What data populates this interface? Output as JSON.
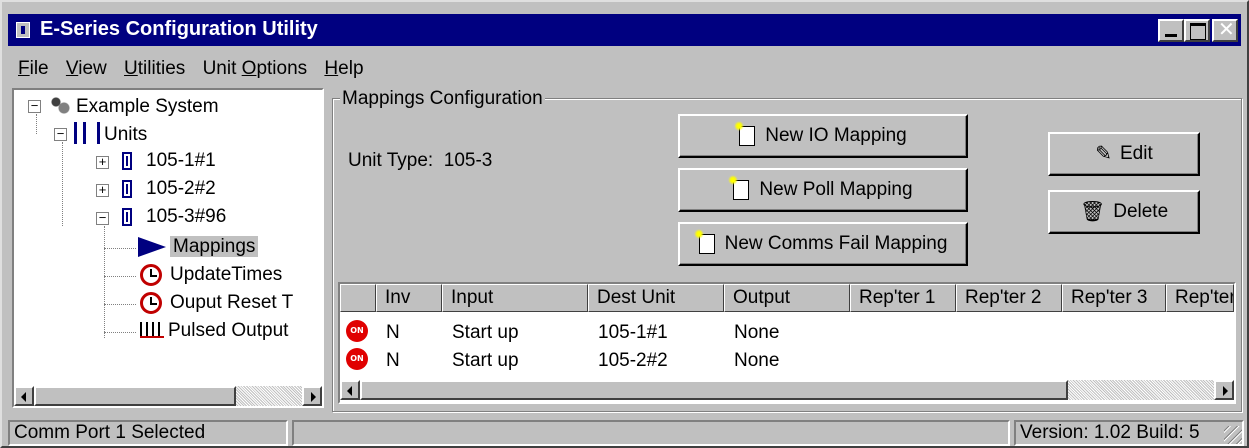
{
  "window": {
    "title": "E-Series Configuration Utility",
    "accent_color": "#000080",
    "face_color": "#c0c0c0",
    "controls": [
      "minimize-icon",
      "maximize-icon",
      "close-icon"
    ],
    "close_glyph": "✕"
  },
  "menu": {
    "items": [
      {
        "ul": "F",
        "rest": "ile"
      },
      {
        "ul": "V",
        "rest": "iew"
      },
      {
        "ul": "U",
        "rest": "tilities"
      },
      {
        "pre": "Unit ",
        "ul": "O",
        "rest": "ptions"
      },
      {
        "ul": "H",
        "rest": "elp"
      }
    ]
  },
  "tree": {
    "root": {
      "label": "Example System",
      "icon": "system-gears-icon",
      "expander": "−"
    },
    "units": {
      "label": "Units",
      "icon": "units-icon",
      "expander": "−"
    },
    "unit_nodes": [
      {
        "label": "105-1#1",
        "expander": "+"
      },
      {
        "label": "105-2#2",
        "expander": "+"
      },
      {
        "label": "105-3#96",
        "expander": "−"
      }
    ],
    "children": [
      {
        "label": "Mappings",
        "icon": "arrow-icon",
        "selected": true
      },
      {
        "label": "UpdateTimes",
        "icon": "clock-icon"
      },
      {
        "label": "Ouput Reset T",
        "icon": "clock-icon"
      },
      {
        "label": "Pulsed Output",
        "icon": "pulse-icon"
      }
    ]
  },
  "mappings": {
    "group_title": "Mappings Configuration",
    "unit_type_label": "Unit Type:",
    "unit_type_value": "105-3",
    "buttons": {
      "new_io": "New IO Mapping",
      "new_poll": "New Poll Mapping",
      "new_comms_fail": "New Comms Fail Mapping",
      "edit": "Edit",
      "delete": "Delete"
    },
    "grid": {
      "columns": [
        "",
        "Inv",
        "Input",
        "Dest Unit",
        "Output",
        "Rep'ter 1",
        "Rep'ter 2",
        "Rep'ter 3",
        "Rep'ter"
      ],
      "rows": [
        {
          "status": "ON",
          "inv": "N",
          "input": "Start up",
          "dest_unit": "105-1#1",
          "output": "None"
        },
        {
          "status": "ON",
          "inv": "N",
          "input": "Start up",
          "dest_unit": "105-2#2",
          "output": "None"
        }
      ]
    }
  },
  "status_bar": {
    "left": "Comm Port 1 Selected",
    "middle": "",
    "right": "Version: 1.02 Build: 5"
  }
}
